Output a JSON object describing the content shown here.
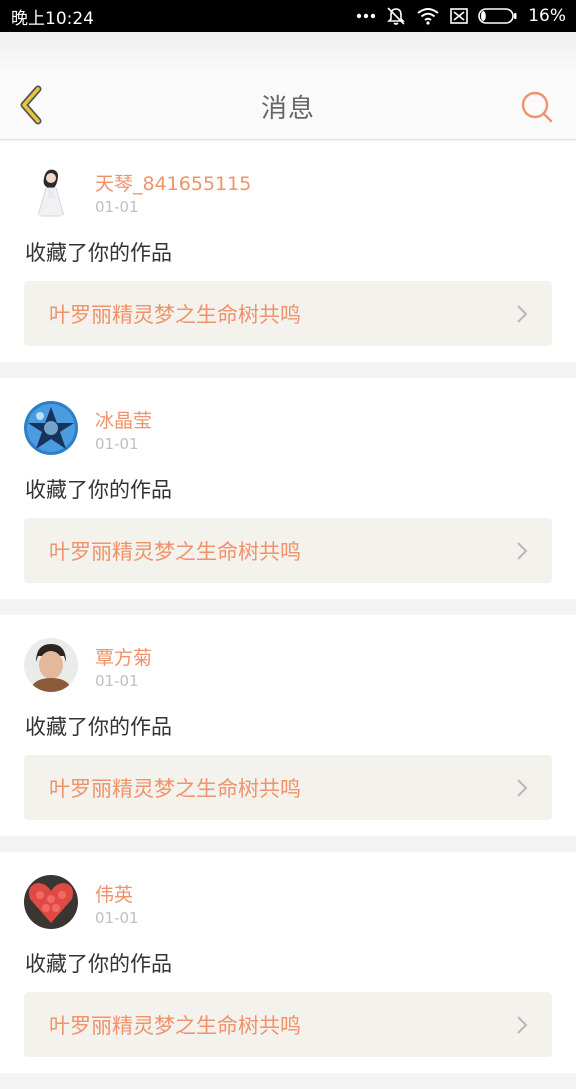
{
  "status_bar": {
    "time": "晚上10:24",
    "battery": "16%",
    "battery_level": 0.16,
    "icons": [
      "dots-icon",
      "mute-icon",
      "wifi-icon",
      "sim-icon",
      "battery-icon"
    ]
  },
  "header": {
    "title": "消息",
    "back_icon": "chevron-left-icon",
    "search_icon": "search-icon"
  },
  "colors": {
    "accent": "#f0926a",
    "back_icon": "#e8c53a",
    "card_link_bg": "#f3f2ec"
  },
  "messages": [
    {
      "username": "天琴_841655115",
      "date": "01-01",
      "action": "收藏了你的作品",
      "work_title": "叶罗丽精灵梦之生命树共鸣",
      "avatar": "doll-avatar"
    },
    {
      "username": "冰晶莹",
      "date": "01-01",
      "action": "收藏了你的作品",
      "work_title": "叶罗丽精灵梦之生命树共鸣",
      "avatar": "crystal-avatar"
    },
    {
      "username": "覃方菊",
      "date": "01-01",
      "action": "收藏了你的作品",
      "work_title": "叶罗丽精灵梦之生命树共鸣",
      "avatar": "photo-avatar"
    },
    {
      "username": "伟英",
      "date": "01-01",
      "action": "收藏了你的作品",
      "work_title": "叶罗丽精灵梦之生命树共鸣",
      "avatar": "roses-avatar"
    }
  ]
}
